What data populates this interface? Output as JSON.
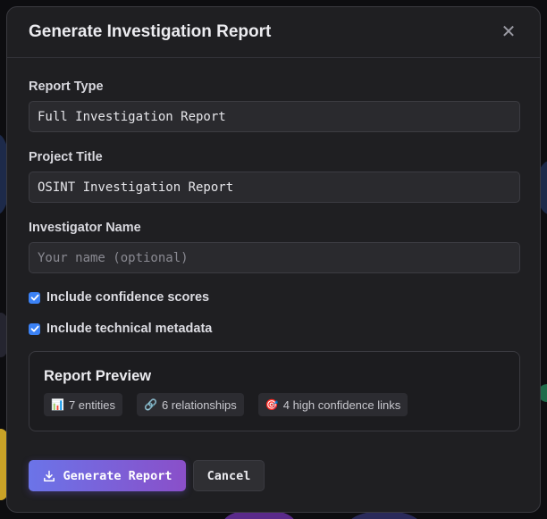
{
  "modal": {
    "title": "Generate Investigation Report",
    "close_icon": "close-icon"
  },
  "fields": {
    "report_type": {
      "label": "Report Type",
      "value": "Full Investigation Report"
    },
    "project_title": {
      "label": "Project Title",
      "value": "OSINT Investigation Report"
    },
    "investigator_name": {
      "label": "Investigator Name",
      "value": "",
      "placeholder": "Your name (optional)"
    }
  },
  "options": {
    "include_confidence": {
      "label": "Include confidence scores",
      "checked": true
    },
    "include_metadata": {
      "label": "Include technical metadata",
      "checked": true
    }
  },
  "preview": {
    "title": "Report Preview",
    "chips": [
      {
        "icon": "📊",
        "text": "7 entities"
      },
      {
        "icon": "🔗",
        "text": "6 relationships"
      },
      {
        "icon": "🎯",
        "text": "4 high confidence links"
      }
    ]
  },
  "buttons": {
    "generate_label": "Generate Report",
    "cancel_label": "Cancel"
  },
  "colors": {
    "accent_start": "#6b74e8",
    "accent_end": "#8a4fc9",
    "checkbox": "#3b82f6"
  }
}
